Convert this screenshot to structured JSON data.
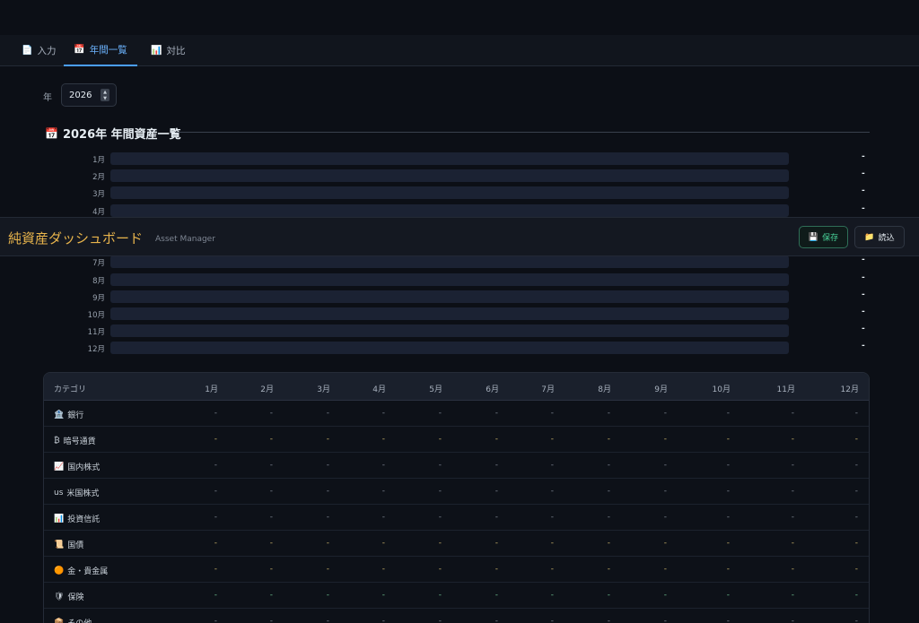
{
  "tabs": [
    {
      "icon": "📄",
      "label": "入力",
      "active": false
    },
    {
      "icon": "📅",
      "label": "年間一覧",
      "active": true
    },
    {
      "icon": "📊",
      "label": "対比",
      "active": false
    }
  ],
  "year": {
    "label": "年",
    "value": "2026"
  },
  "section": {
    "icon": "📅",
    "title": "2026年 年間資産一覧"
  },
  "monthly_bars": [
    {
      "label": "1月",
      "value": "-"
    },
    {
      "label": "2月",
      "value": "-"
    },
    {
      "label": "3月",
      "value": "-"
    },
    {
      "label": "4月",
      "value": "-"
    },
    {
      "label": "7月",
      "value": "-"
    },
    {
      "label": "8月",
      "value": "-"
    },
    {
      "label": "9月",
      "value": "-"
    },
    {
      "label": "10月",
      "value": "-"
    },
    {
      "label": "11月",
      "value": "-"
    },
    {
      "label": "12月",
      "value": "-"
    }
  ],
  "header": {
    "title": "純資産ダッシュボード",
    "subtitle": "Asset Manager",
    "save_icon": "💾",
    "save_label": "保存",
    "load_icon": "📁",
    "load_label": "読込"
  },
  "table": {
    "columns": [
      "カテゴリ",
      "1月",
      "2月",
      "3月",
      "4月",
      "5月",
      "6月",
      "7月",
      "8月",
      "9月",
      "10月",
      "11月",
      "12月"
    ],
    "rows": [
      {
        "icon": "🏦",
        "name": "銀行",
        "color": "#7d8592",
        "cells": [
          "-",
          "-",
          "-",
          "-",
          "-",
          "-",
          "-",
          "-",
          "-",
          "-",
          "-",
          "-"
        ]
      },
      {
        "icon": "₿",
        "name": "暗号通貨",
        "color": "#c9b26a",
        "cells": [
          "-",
          "-",
          "-",
          "-",
          "-",
          "-",
          "-",
          "-",
          "-",
          "-",
          "-",
          "-"
        ]
      },
      {
        "icon": "📈",
        "name": "国内株式",
        "color": "#7d8592",
        "cells": [
          "-",
          "-",
          "-",
          "-",
          "-",
          "-",
          "-",
          "-",
          "-",
          "-",
          "-",
          "-"
        ]
      },
      {
        "icon": "us",
        "name": "米国株式",
        "color": "#7d8592",
        "cells": [
          "-",
          "-",
          "-",
          "-",
          "-",
          "-",
          "-",
          "-",
          "-",
          "-",
          "-",
          "-"
        ]
      },
      {
        "icon": "📊",
        "name": "投資信託",
        "color": "#7d8592",
        "cells": [
          "-",
          "-",
          "-",
          "-",
          "-",
          "-",
          "-",
          "-",
          "-",
          "-",
          "-",
          "-"
        ]
      },
      {
        "icon": "📜",
        "name": "国債",
        "color": "#c9b26a",
        "cells": [
          "-",
          "-",
          "-",
          "-",
          "-",
          "-",
          "-",
          "-",
          "-",
          "-",
          "-",
          "-"
        ]
      },
      {
        "icon": "🟠",
        "name": "金・貴金属",
        "color": "#c9b26a",
        "cells": [
          "-",
          "-",
          "-",
          "-",
          "-",
          "-",
          "-",
          "-",
          "-",
          "-",
          "-",
          "-"
        ]
      },
      {
        "icon": "🛡",
        "name": "保険",
        "color": "#6fbf8f",
        "cells": [
          "-",
          "-",
          "-",
          "-",
          "-",
          "-",
          "-",
          "-",
          "-",
          "-",
          "-",
          "-"
        ]
      },
      {
        "icon": "📦",
        "name": "その他",
        "color": "#7d8592",
        "cells": [
          "-",
          "-",
          "-",
          "-",
          "-",
          "-",
          "-",
          "-",
          "-",
          "-",
          "-",
          "-"
        ]
      }
    ]
  }
}
